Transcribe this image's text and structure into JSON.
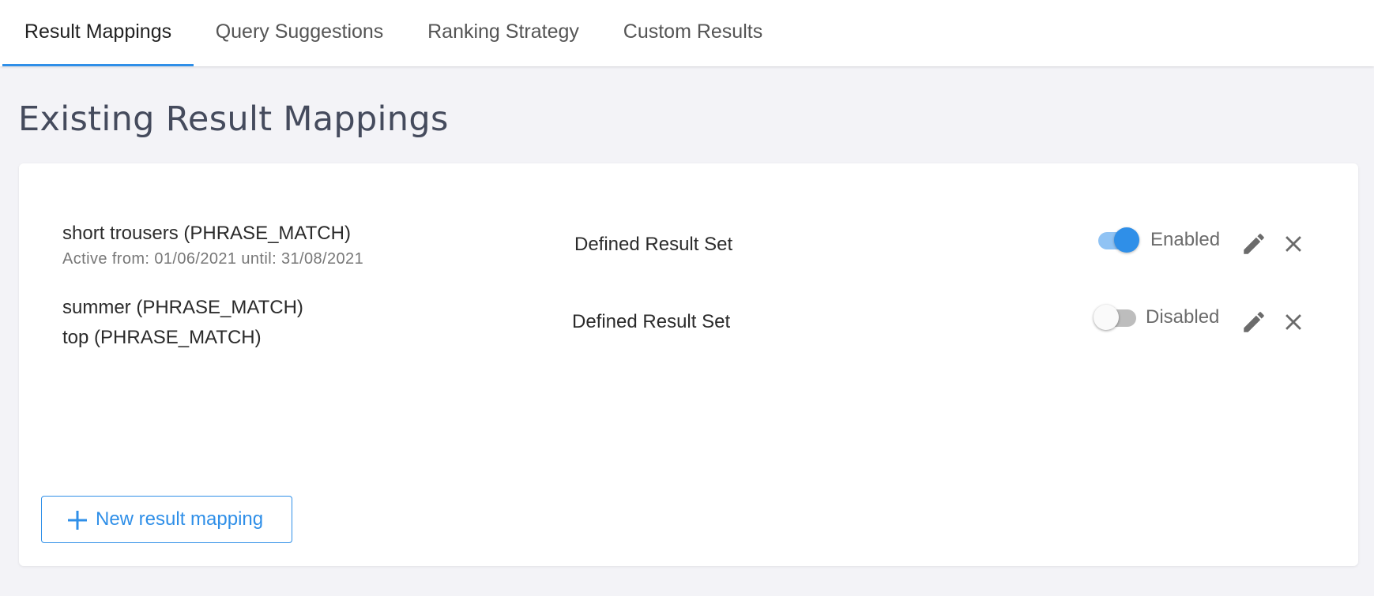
{
  "tabs": [
    {
      "label": "Result Mappings",
      "active": true
    },
    {
      "label": "Query Suggestions",
      "active": false
    },
    {
      "label": "Ranking Strategy",
      "active": false
    },
    {
      "label": "Custom Results",
      "active": false
    }
  ],
  "page": {
    "title": "Existing Result Mappings"
  },
  "mappings": [
    {
      "queries": [
        "short trousers (PHRASE_MATCH)"
      ],
      "active_period": "Active from: 01/06/2021 until: 31/08/2021",
      "type": "Defined Result Set",
      "enabled": true,
      "status_label": "Enabled"
    },
    {
      "queries": [
        "summer (PHRASE_MATCH)",
        "top (PHRASE_MATCH)"
      ],
      "type": "Defined Result Set",
      "enabled": false,
      "status_label": "Disabled"
    }
  ],
  "actions": {
    "new_mapping_label": "New result mapping"
  },
  "colors": {
    "accent": "#2f8fe8",
    "background": "#f3f3f7",
    "title": "#454b5d"
  },
  "icons": [
    "edit-pencil-icon",
    "close-x-icon",
    "plus-icon"
  ]
}
